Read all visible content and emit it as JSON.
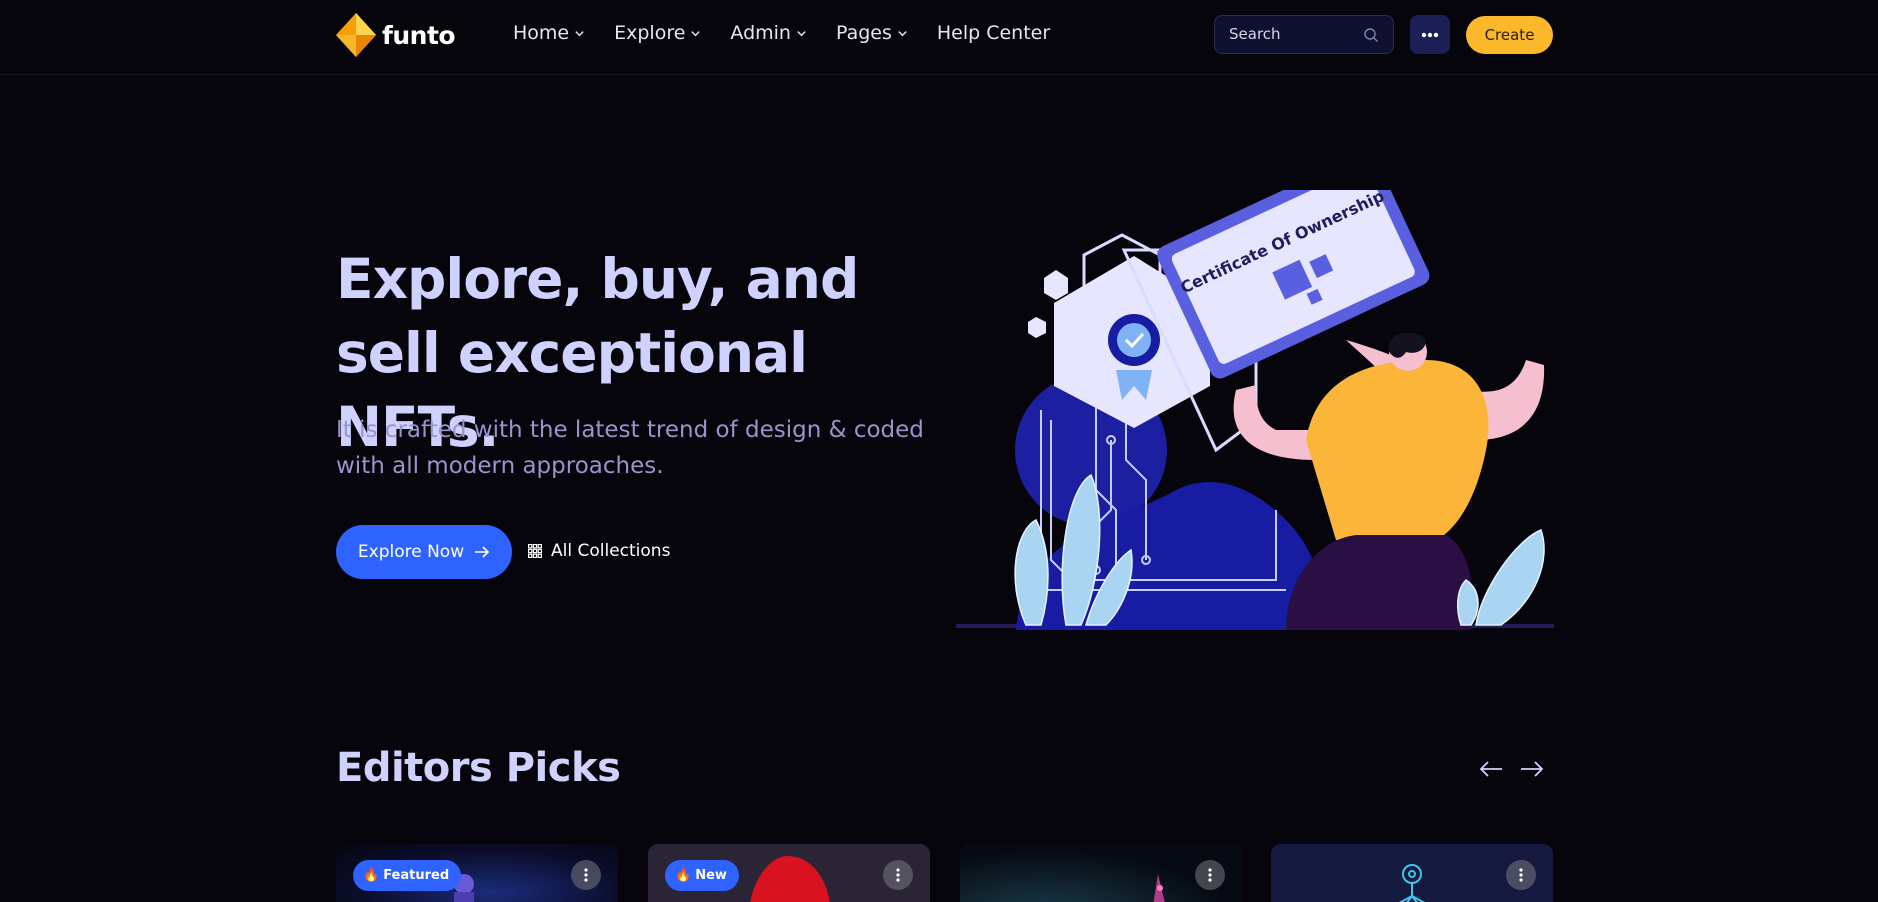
{
  "header": {
    "logo_text": "funto",
    "menu": [
      {
        "label": "Home",
        "has_dropdown": true
      },
      {
        "label": "Explore",
        "has_dropdown": true
      },
      {
        "label": "Admin",
        "has_dropdown": true
      },
      {
        "label": "Pages",
        "has_dropdown": true
      },
      {
        "label": "Help Center",
        "has_dropdown": false
      }
    ],
    "search_placeholder": "Search",
    "create_label": "Create"
  },
  "hero": {
    "title": "Explore, buy, and sell exceptional NFTs.",
    "subtitle": "It is crafted with the latest trend of design & coded with all modern approaches.",
    "primary_cta": "Explore Now",
    "secondary_cta": "All Collections",
    "illustration": {
      "certificate_text": "Certificate Of Ownership"
    }
  },
  "editors_picks": {
    "title": "Editors Picks",
    "cards": [
      {
        "badge": "Featured",
        "badge_icon": "flame-icon",
        "theme": "dark-blue"
      },
      {
        "badge": "New",
        "badge_icon": "flame-icon",
        "theme": "santa"
      },
      {
        "badge": "",
        "theme": "dark-teal"
      },
      {
        "badge": "",
        "theme": "navy-network"
      }
    ]
  },
  "colors": {
    "background": "#06050b",
    "accent_blue": "#2f63ff",
    "accent_yellow": "#fbb82a",
    "heading": "#cfd2ff",
    "muted_text": "#9895cc"
  }
}
